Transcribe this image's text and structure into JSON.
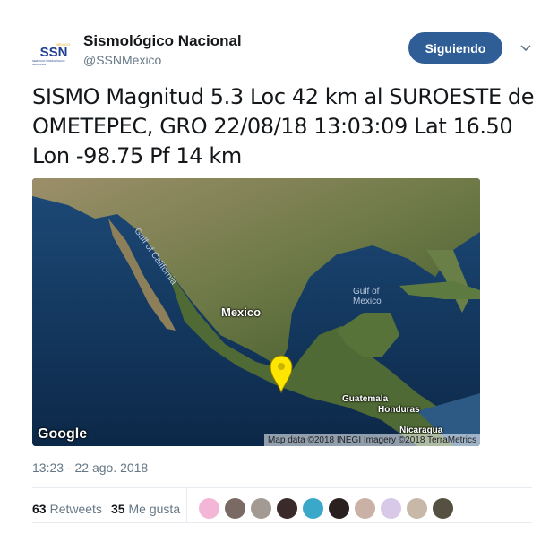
{
  "account": {
    "name": "Sismológico Nacional",
    "handle": "@SSNMexico",
    "avatar_text": "SSN",
    "avatar_top": "MEXICO",
    "avatar_sub": "SERVICIO SISMOLÓGICO NACIONAL"
  },
  "follow_button": {
    "label": "Siguiendo"
  },
  "tweet": {
    "text": "SISMO Magnitud 5.3 Loc  42 km al SUROESTE de OMETEPEC, GRO 22/08/18 13:03:09 Lat 16.50 Lon -98.75 Pf 14 km"
  },
  "map": {
    "labels": {
      "mexico": "Mexico",
      "gulf_of_california": "Gulf of California",
      "gulf_of_mexico_1": "Gulf of",
      "gulf_of_mexico_2": "Mexico",
      "guatemala": "Guatemala",
      "honduras": "Honduras",
      "nicaragua": "Nicaragua"
    },
    "google_logo": "Google",
    "attribution": "Map data ©2018 INEGI  Imagery ©2018 TerraMetrics",
    "marker_color": "#ffe600"
  },
  "timestamp": "13:23 - 22 ago. 2018",
  "stats": {
    "retweets_count": "63",
    "retweets_label": "Retweets",
    "likes_count": "35",
    "likes_label": "Me gusta"
  },
  "liker_colors": [
    "#f3b6d6",
    "#7b6a64",
    "#a39b93",
    "#3a2b2a",
    "#3aa9c9",
    "#2a2020",
    "#c9b1a5",
    "#d8c9e8",
    "#c8b8a8",
    "#555042"
  ],
  "colors": {
    "accent": "#2f5e97",
    "muted": "#657786"
  }
}
